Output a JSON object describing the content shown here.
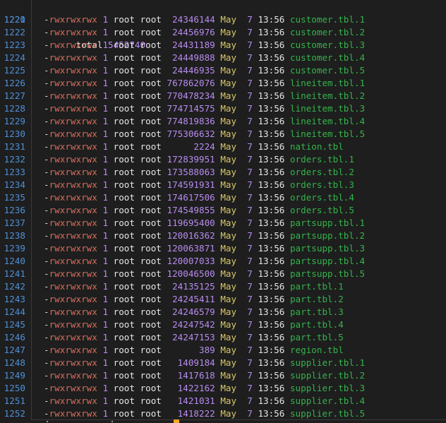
{
  "terminal": {
    "total": {
      "line": "1220",
      "label": "total",
      "value": "5452740"
    },
    "rows": [
      {
        "ln": "1221",
        "perm": "rwxrwxrwx",
        "links": "1",
        "user": "root",
        "group": "root",
        "size": "24346144",
        "month": "May",
        "day": "7",
        "time": "13:56",
        "name": "customer.tbl.1"
      },
      {
        "ln": "1222",
        "perm": "rwxrwxrwx",
        "links": "1",
        "user": "root",
        "group": "root",
        "size": "24456976",
        "month": "May",
        "day": "7",
        "time": "13:56",
        "name": "customer.tbl.2"
      },
      {
        "ln": "1223",
        "perm": "rwxrwxrwx",
        "links": "1",
        "user": "root",
        "group": "root",
        "size": "24431189",
        "month": "May",
        "day": "7",
        "time": "13:56",
        "name": "customer.tbl.3"
      },
      {
        "ln": "1224",
        "perm": "rwxrwxrwx",
        "links": "1",
        "user": "root",
        "group": "root",
        "size": "24449888",
        "month": "May",
        "day": "7",
        "time": "13:56",
        "name": "customer.tbl.4"
      },
      {
        "ln": "1225",
        "perm": "rwxrwxrwx",
        "links": "1",
        "user": "root",
        "group": "root",
        "size": "24446935",
        "month": "May",
        "day": "7",
        "time": "13:56",
        "name": "customer.tbl.5"
      },
      {
        "ln": "1226",
        "perm": "rwxrwxrwx",
        "links": "1",
        "user": "root",
        "group": "root",
        "size": "767862076",
        "month": "May",
        "day": "7",
        "time": "13:56",
        "name": "lineitem.tbl.1"
      },
      {
        "ln": "1227",
        "perm": "rwxrwxrwx",
        "links": "1",
        "user": "root",
        "group": "root",
        "size": "770478234",
        "month": "May",
        "day": "7",
        "time": "13:56",
        "name": "lineitem.tbl.2"
      },
      {
        "ln": "1228",
        "perm": "rwxrwxrwx",
        "links": "1",
        "user": "root",
        "group": "root",
        "size": "774714575",
        "month": "May",
        "day": "7",
        "time": "13:56",
        "name": "lineitem.tbl.3"
      },
      {
        "ln": "1229",
        "perm": "rwxrwxrwx",
        "links": "1",
        "user": "root",
        "group": "root",
        "size": "774819836",
        "month": "May",
        "day": "7",
        "time": "13:56",
        "name": "lineitem.tbl.4"
      },
      {
        "ln": "1230",
        "perm": "rwxrwxrwx",
        "links": "1",
        "user": "root",
        "group": "root",
        "size": "775306632",
        "month": "May",
        "day": "7",
        "time": "13:56",
        "name": "lineitem.tbl.5"
      },
      {
        "ln": "1231",
        "perm": "rwxrwxrwx",
        "links": "1",
        "user": "root",
        "group": "root",
        "size": "2224",
        "month": "May",
        "day": "7",
        "time": "13:56",
        "name": "nation.tbl"
      },
      {
        "ln": "1232",
        "perm": "rwxrwxrwx",
        "links": "1",
        "user": "root",
        "group": "root",
        "size": "172839951",
        "month": "May",
        "day": "7",
        "time": "13:56",
        "name": "orders.tbl.1"
      },
      {
        "ln": "1233",
        "perm": "rwxrwxrwx",
        "links": "1",
        "user": "root",
        "group": "root",
        "size": "173588063",
        "month": "May",
        "day": "7",
        "time": "13:56",
        "name": "orders.tbl.2"
      },
      {
        "ln": "1234",
        "perm": "rwxrwxrwx",
        "links": "1",
        "user": "root",
        "group": "root",
        "size": "174591931",
        "month": "May",
        "day": "7",
        "time": "13:56",
        "name": "orders.tbl.3"
      },
      {
        "ln": "1235",
        "perm": "rwxrwxrwx",
        "links": "1",
        "user": "root",
        "group": "root",
        "size": "174617506",
        "month": "May",
        "day": "7",
        "time": "13:56",
        "name": "orders.tbl.4"
      },
      {
        "ln": "1236",
        "perm": "rwxrwxrwx",
        "links": "1",
        "user": "root",
        "group": "root",
        "size": "174549855",
        "month": "May",
        "day": "7",
        "time": "13:56",
        "name": "orders.tbl.5"
      },
      {
        "ln": "1237",
        "perm": "rwxrwxrwx",
        "links": "1",
        "user": "root",
        "group": "root",
        "size": "119695400",
        "month": "May",
        "day": "7",
        "time": "13:56",
        "name": "partsupp.tbl.1"
      },
      {
        "ln": "1238",
        "perm": "rwxrwxrwx",
        "links": "1",
        "user": "root",
        "group": "root",
        "size": "120016362",
        "month": "May",
        "day": "7",
        "time": "13:56",
        "name": "partsupp.tbl.2"
      },
      {
        "ln": "1239",
        "perm": "rwxrwxrwx",
        "links": "1",
        "user": "root",
        "group": "root",
        "size": "120063871",
        "month": "May",
        "day": "7",
        "time": "13:56",
        "name": "partsupp.tbl.3"
      },
      {
        "ln": "1240",
        "perm": "rwxrwxrwx",
        "links": "1",
        "user": "root",
        "group": "root",
        "size": "120007033",
        "month": "May",
        "day": "7",
        "time": "13:56",
        "name": "partsupp.tbl.4"
      },
      {
        "ln": "1241",
        "perm": "rwxrwxrwx",
        "links": "1",
        "user": "root",
        "group": "root",
        "size": "120046500",
        "month": "May",
        "day": "7",
        "time": "13:56",
        "name": "partsupp.tbl.5"
      },
      {
        "ln": "1242",
        "perm": "rwxrwxrwx",
        "links": "1",
        "user": "root",
        "group": "root",
        "size": "24135125",
        "month": "May",
        "day": "7",
        "time": "13:56",
        "name": "part.tbl.1"
      },
      {
        "ln": "1243",
        "perm": "rwxrwxrwx",
        "links": "1",
        "user": "root",
        "group": "root",
        "size": "24245411",
        "month": "May",
        "day": "7",
        "time": "13:56",
        "name": "part.tbl.2"
      },
      {
        "ln": "1244",
        "perm": "rwxrwxrwx",
        "links": "1",
        "user": "root",
        "group": "root",
        "size": "24246579",
        "month": "May",
        "day": "7",
        "time": "13:56",
        "name": "part.tbl.3"
      },
      {
        "ln": "1245",
        "perm": "rwxrwxrwx",
        "links": "1",
        "user": "root",
        "group": "root",
        "size": "24247542",
        "month": "May",
        "day": "7",
        "time": "13:56",
        "name": "part.tbl.4"
      },
      {
        "ln": "1246",
        "perm": "rwxrwxrwx",
        "links": "1",
        "user": "root",
        "group": "root",
        "size": "24247153",
        "month": "May",
        "day": "7",
        "time": "13:56",
        "name": "part.tbl.5"
      },
      {
        "ln": "1247",
        "perm": "rwxrwxrwx",
        "links": "1",
        "user": "root",
        "group": "root",
        "size": "389",
        "month": "May",
        "day": "7",
        "time": "13:56",
        "name": "region.tbl"
      },
      {
        "ln": "1248",
        "perm": "rwxrwxrwx",
        "links": "1",
        "user": "root",
        "group": "root",
        "size": "1409184",
        "month": "May",
        "day": "7",
        "time": "13:56",
        "name": "supplier.tbl.1"
      },
      {
        "ln": "1249",
        "perm": "rwxrwxrwx",
        "links": "1",
        "user": "root",
        "group": "root",
        "size": "1417618",
        "month": "May",
        "day": "7",
        "time": "13:56",
        "name": "supplier.tbl.2"
      },
      {
        "ln": "1250",
        "perm": "rwxrwxrwx",
        "links": "1",
        "user": "root",
        "group": "root",
        "size": "1422162",
        "month": "May",
        "day": "7",
        "time": "13:56",
        "name": "supplier.tbl.3"
      },
      {
        "ln": "1251",
        "perm": "rwxrwxrwx",
        "links": "1",
        "user": "root",
        "group": "root",
        "size": "1421031",
        "month": "May",
        "day": "7",
        "time": "13:56",
        "name": "supplier.tbl.4"
      },
      {
        "ln": "1252",
        "perm": "rwxrwxrwx",
        "links": "1",
        "user": "root",
        "group": "root",
        "size": "1418222",
        "month": "May",
        "day": "7",
        "time": "13:56",
        "name": "supplier.tbl.5"
      }
    ],
    "colors": {
      "background": "#1e1e1e",
      "line_number": "#4f8fd6",
      "permission": "#d46d5c",
      "number": "#b88cf0",
      "month": "#d8c86a",
      "filename": "#34b34b",
      "cursor": "#f5a623"
    }
  }
}
